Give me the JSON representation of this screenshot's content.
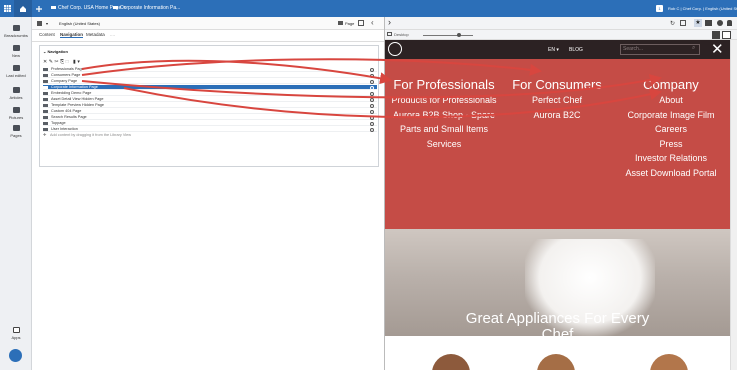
{
  "topbar": {
    "tab1": "Chef Corp. USA Home Page",
    "tab2": "Corporate Information Pa...",
    "user": "Rob C | Chef Corp. | English (United States)",
    "badge": "1"
  },
  "leftrail": {
    "items": [
      "Breadcrumbs",
      "New",
      "Last edited",
      "Articles",
      "Pictures",
      "Pages"
    ],
    "apps": "Apps"
  },
  "editor": {
    "language": "English (United States)",
    "page_label": "Page",
    "tabs": [
      "Content",
      "Navigation",
      "Metadata",
      "...."
    ],
    "panel_title": "Navigation",
    "rows": [
      "Professionals Page",
      "Consumers Page",
      "Company Page",
      "Corporate Information Page",
      "Embedding Demo Page",
      "Asset Detail View Hidden Page",
      "Template Preview Hidden Page",
      "Custom 404 Page",
      "Search Results Page",
      "Toppage",
      "User Interaction"
    ],
    "selected_index": 3,
    "drop_hint": "Add content by dragging it from the Library View"
  },
  "preview": {
    "zoom_label": "Desktop",
    "nav": {
      "lang": "EN",
      "blog": "BLOG",
      "search_placeholder": "Search..."
    },
    "menu": {
      "columns": [
        {
          "heading": "For Professionals",
          "items": [
            "Products for Professionals",
            "Aurora B2B Shop - Spare",
            "Parts and Small Items",
            "Services"
          ]
        },
        {
          "heading": "For Consumers",
          "items": [
            "Perfect Chef",
            "Aurora B2C"
          ]
        },
        {
          "heading": "Company",
          "items": [
            "About",
            "Corporate Image Film",
            "Careers",
            "Press",
            "Investor Relations",
            "Asset Download Portal"
          ]
        }
      ]
    },
    "hero": {
      "line1": "Great Appliances For Every",
      "line2": "Chef"
    }
  },
  "colors": {
    "accent": "#2c6fb8",
    "menu_red": "#c54c46",
    "site_dark": "#2c2223",
    "arrow": "#d8463f"
  }
}
